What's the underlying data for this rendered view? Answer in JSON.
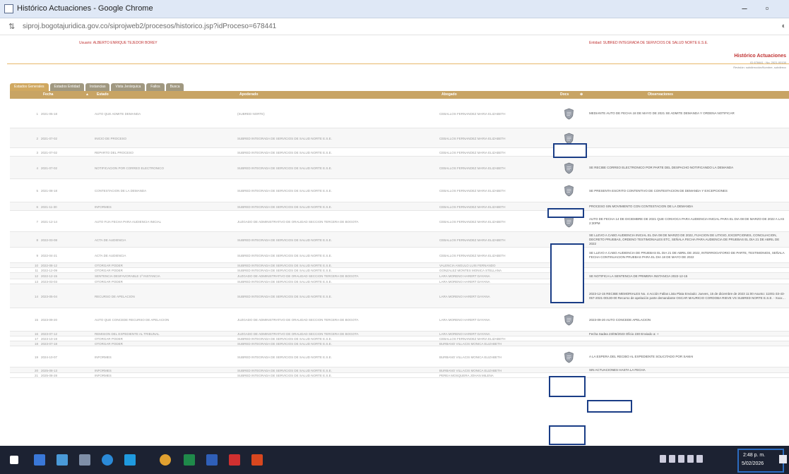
{
  "window": {
    "title": "Histórico Actuaciones - Google Chrome",
    "minimize": "–",
    "maximize": "▫"
  },
  "address": {
    "url": "siproj.bogotajuridica.gov.co/siprojweb2/procesos/historico.jsp?idProceso=678441"
  },
  "info": {
    "usuario": "Usuario: ALBERTO ENRIQUE TEJEDOR BOREY",
    "entidad": "Entidad: SUBRED INTEGRADA DE SERVICIOS DE SALUD NORTE E.S.E.",
    "page_title": "Histórico Actuaciones",
    "meta1": "ID 678441 · No. 2021-00130",
    "meta2": "Revisión: subdirección/Nombre, subdirecc"
  },
  "tabs": [
    "Estados Generales",
    "Estados Entidad",
    "Instancias",
    "Vista Jerárquica",
    "Fallos",
    "Busca"
  ],
  "columns": {
    "fecha": "Fecha",
    "estado": "Estado",
    "apoderado": "Apoderado",
    "abogado": "Abogado",
    "docs": "Docs",
    "observaciones": "Observaciones"
  },
  "rows": [
    {
      "n": "1",
      "fecha": "2021-05-18",
      "estado": "AUTO QUE ADMITE DEMANDA",
      "apoderado": "(SUBRED NORTE)",
      "abogado": "CEBALLOS FERNANDEZ MARIA ELIZABETH",
      "doc": true,
      "obs": "MEDIANTE AUTO DE FECHA 18 DE MAYO DE 2021 SE ADMITE DEMANDA Y ORDENA NOTIFICAR"
    },
    {
      "n": "2",
      "fecha": "2021-07-02",
      "estado": "INICIO DE PROCESO",
      "apoderado": "SUBRED INTEGRADA DE SERVICIOS DE SALUD NORTE E.S.E.",
      "abogado": "CEBALLOS FERNANDEZ MARIA ELIZABETH",
      "doc": true,
      "obs": ""
    },
    {
      "n": "3",
      "fecha": "2021-07-02",
      "estado": "REPARTO DEL PROCESO",
      "apoderado": "SUBRED INTEGRADA DE SERVICIOS DE SALUD NORTE E.S.E.",
      "abogado": "CEBALLOS FERNANDEZ MARIA ELIZABETH",
      "doc": false,
      "obs": ""
    },
    {
      "n": "4",
      "fecha": "2021-07-02",
      "estado": "NOTIFICACION POR CORREO ELECTRONICO",
      "apoderado": "SUBRED INTEGRADA DE SERVICIOS DE SALUD NORTE E.S.E.",
      "abogado": "CEBALLOS FERNANDEZ MARIA ELIZABETH",
      "doc": true,
      "obs": "SE RECIBE CORREO ELECTRONICO POR PARTE DEL DESPACHO NOTIFICANDO LA DEMANDA"
    },
    {
      "n": "5",
      "fecha": "2021-08-18",
      "estado": "CONTESTACION DE LA DEMANDA",
      "apoderado": "SUBRED INTEGRADA DE SERVICIOS DE SALUD NORTE E.S.E.",
      "abogado": "CEBALLOS FERNANDEZ MARIA ELIZABETH",
      "doc": true,
      "obs": "SE PRESENTA ESCRITO CONTENTIVO DE CONTESTACION DE DEMANDA Y EXCEPCIONES"
    },
    {
      "n": "6",
      "fecha": "2021-11-30",
      "estado": "INFORMES",
      "apoderado": "SUBRED INTEGRADA DE SERVICIOS DE SALUD NORTE E.S.E.",
      "abogado": "CEBALLOS FERNANDEZ MARIA ELIZABETH",
      "doc": false,
      "obs": "PROCESO SIN MOVIMIENTO CON CONTESTACION DE LA DEMANDA"
    },
    {
      "n": "7",
      "fecha": "2021-12-14",
      "estado": "AUTO FIJA FECHA PARA AUDIENCIA INICIAL",
      "apoderado": "JUZGADO DE ADMINISTRATIVO DE ORALIDAD SECCION TERCERA DE BOGOTA",
      "abogado": "CEBALLOS FERNANDEZ MARIA ELIZABETH",
      "doc": true,
      "obs": "AUTO DE FECHA 14 DE DICIEMBRE DE 2021 QUE CONVOCA PARA AUDIENCIA INICIAL PARA EL DIA 08 DE MARZO DE 2022 A LAS 2:30PM"
    },
    {
      "n": "8",
      "fecha": "2022-03-08",
      "estado": "ACTA DE AUDIENCIA",
      "apoderado": "SUBRED INTEGRADA DE SERVICIOS DE SALUD NORTE E.S.E.",
      "abogado": "CEBALLOS FERNANDEZ MARIA ELIZABETH",
      "doc": false,
      "obs": "SE LLEVO A CABO AUDIENCIA INICIAL EL DIA 08 DE MARZO DE 2022, FIJACION DE LITIGIO, EXCEPCIONES, CONCILIACION, DECRETO PRUEBAS, ORDENO TESTIMONIALES ETC, SEÑALA FECHA PARA AUDIENCIA DE PRUEBAS EL DIA 21 DE ABRIL DE 2022"
    },
    {
      "n": "9",
      "fecha": "2022-04-21",
      "estado": "ACTA DE AUDIENCIA",
      "apoderado": "SUBRED INTEGRADA DE SERVICIOS DE SALUD NORTE E.S.E.",
      "abogado": "CEBALLOS FERNANDEZ MARIA ELIZABETH",
      "doc": false,
      "obs": "SE LLEVO A CABO AUDIENCIA DE PRUEBAS EL DIA 21 DE ABRIL DE 2022, INTERROGATORIO DE PARTE, TESTIMONIOS, SEÑALA FECHA CONTINUACION PRUEBAS PARA EL DIA 18 DE MAYO DE 2022"
    },
    {
      "n": "10",
      "fecha": "2022-08-12",
      "estado": "OTORGAR PODER",
      "apoderado": "SUBRED INTEGRADA DE SERVICIOS DE SALUD NORTE E.S.E.",
      "abogado": "VALENCIA ANGULO LUIS FERNANDO",
      "doc": false,
      "obs": ""
    },
    {
      "n": "11",
      "fecha": "2022-12-09",
      "estado": "OTORGAR PODER",
      "apoderado": "SUBRED INTEGRADA DE SERVICIOS DE SALUD NORTE E.S.E.",
      "abogado": "GONZALEZ MONTES MONICA STELLANA",
      "doc": false,
      "obs": ""
    },
    {
      "n": "12",
      "fecha": "2022-12-15",
      "estado": "SENTENCIA DESFAVORABLE 1ª INSTANCIA",
      "apoderado": "JUZGADO DE ADMINISTRATIVO DE ORALIDAD SECCION TERCERA DE BOGOTA",
      "abogado": "LARA MORENO HARERT DAYANA",
      "doc": false,
      "obs": "SE NOTIFICA LA SENTENCIA DE PRIMERA INSTANCIA 2022-12-15"
    },
    {
      "n": "13",
      "fecha": "2023-03-03",
      "estado": "OTORGAR PODER",
      "apoderado": "SUBRED INTEGRADA DE SERVICIOS DE SALUD NORTE E.S.E.",
      "abogado": "LARA MORENO HARERT DAYANA",
      "doc": false,
      "obs": ""
    },
    {
      "n": "14",
      "fecha": "2023-05-04",
      "estado": "RECURSO DE APELACION",
      "apoderado": "SUBRED INTEGRADA DE SERVICIOS DE SALUD NORTE E.S.E.",
      "abogado": "LARA MORENO HARERT DAYANA",
      "doc": true,
      "obs": "2023-12-15 RECIBE MEMORIALES No. 4 Acción Fallas Lista Plata Enviado: Jueves, 15 de diciembre de 2023 11:00 Asunto: 11001-33-43-057-2021-00130-00 Recurso de apelación parte demandante OSCAR MAURICIO CORDOBA RIEVE VS SUBRED NORTE E.S.E. - Xxxx…"
    },
    {
      "n": "15",
      "fecha": "2023-09-20",
      "estado": "AUTO QUE CONCEDE RECURSO DE APELACION",
      "apoderado": "JUZGADO DE ADMINISTRATIVO DE ORALIDAD SECCION TERCERA DE BOGOTA",
      "abogado": "LARA MORENO HARERT DAYANA",
      "doc": true,
      "obs": "2023-09-20 AUTO CONCEDE APELACION"
    },
    {
      "n": "16",
      "fecha": "2023-07-12",
      "estado": "REMISION DEL EXPEDIENTE AL TRIBUNAL",
      "apoderado": "JUZGADO DE ADMINISTRATIVO DE ORALIDAD SECCION TERCERA DE BOGOTA",
      "abogado": "LARA MORENO HARERT DAYANA",
      "doc": false,
      "obs": "Fecha Sadea 23/06/2023 Oficio 230 Enviado a: +"
    },
    {
      "n": "17",
      "fecha": "2023-10-19",
      "estado": "OTORGAR PODER",
      "apoderado": "SUBRED INTEGRADA DE SERVICIOS DE SALUD NORTE E.S.E.",
      "abogado": "CEBALLOS FERNANDEZ MARIA ELIZABETH",
      "doc": false,
      "obs": ""
    },
    {
      "n": "18",
      "fecha": "2023-07-18",
      "estado": "OTORGAR PODER",
      "apoderado": "SUBRED INTEGRADA DE SERVICIOS DE SALUD NORTE E.S.E.",
      "abogado": "BURBANO VILLACIS MONICA ELIZABETH",
      "doc": false,
      "obs": ""
    },
    {
      "n": "19",
      "fecha": "2024-10-07",
      "estado": "INFORMES",
      "apoderado": "SUBRED INTEGRADA DE SERVICIOS DE SALUD NORTE E.S.E.",
      "abogado": "BURBANO VILLACIS MONICA ELIZABETH",
      "doc": true,
      "obs": "A LA ESPERA DEL RECIBO AL EXPEDIENTE SOLICITADO POR SAMAI"
    },
    {
      "n": "20",
      "fecha": "2025-08-13",
      "estado": "INFORMES",
      "apoderado": "SUBRED INTEGRADA DE SERVICIOS DE SALUD NORTE E.S.E.",
      "abogado": "BURBANO VILLACIS MONICA ELIZABETH",
      "doc": false,
      "obs": "SIN ACTUACIONES HASTA LA FECHA"
    },
    {
      "n": "21",
      "fecha": "2025-08-28",
      "estado": "INFORMES",
      "apoderado": "SUBRED INTEGRADA DE SERVICIOS DE SALUD NORTE E.S.E.",
      "abogado": "PEREA MOSQUERA JOHAN MILENA",
      "doc": false,
      "obs": ""
    }
  ],
  "apoderado_tag": "(SUBRED NORTE)",
  "taskbar": {
    "time": "2:48 p. m.",
    "date": "5/02/2026"
  },
  "colors": {
    "accent": "#c8a464",
    "brand_red": "#c03333",
    "highlight_box": "#1a3d86"
  }
}
